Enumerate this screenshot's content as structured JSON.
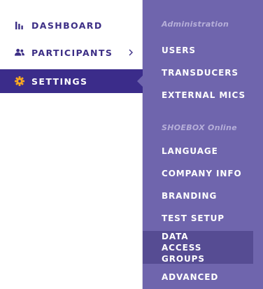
{
  "sidebar": {
    "items": [
      {
        "label": "DASHBOARD",
        "icon": "bar-chart-icon"
      },
      {
        "label": "PARTICIPANTS",
        "icon": "users-icon",
        "has_submenu": true
      },
      {
        "label": "SETTINGS",
        "icon": "gear-icon",
        "active": true
      }
    ]
  },
  "submenu": {
    "sections": [
      {
        "header": "Administration",
        "items": [
          "USERS",
          "TRANSDUCERS",
          "EXTERNAL MICS"
        ]
      },
      {
        "header": "SHOEBOX Online",
        "items": [
          "LANGUAGE",
          "COMPANY INFO",
          "BRANDING",
          "TEST SETUP",
          "DATA ACCESS GROUPS",
          "ADVANCED"
        ]
      }
    ],
    "highlighted_item": "DATA ACCESS GROUPS"
  },
  "colors": {
    "brand_dark": "#3b2c8a",
    "nav_text": "#3d2f86",
    "panel_bg": "#6f65ad",
    "panel_highlight": "#564c93",
    "section_header": "#b6afd9",
    "settings_icon": "#f5a623"
  }
}
